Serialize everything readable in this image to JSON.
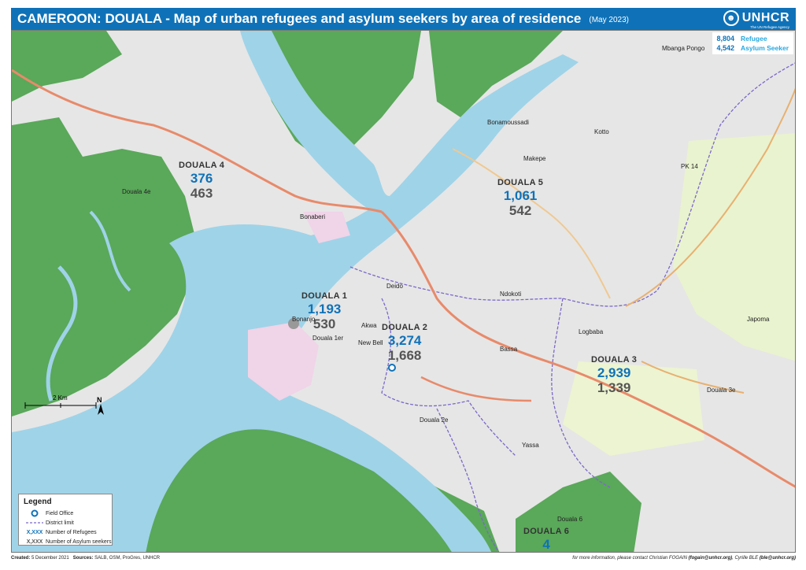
{
  "header": {
    "title": "CAMEROON: DOUALA -  Map of urban refugees and asylum seekers by area of residence",
    "date": "(May 2023)",
    "logo_text": "UNHCR",
    "logo_tagline": "The UN Refugee Agency"
  },
  "summary": {
    "refugees_value": "8,804",
    "refugees_label": "Refugee",
    "asylum_value": "4,542",
    "asylum_label": "Asylum Seeker"
  },
  "districts": [
    {
      "name": "DOUALA 4",
      "refugees": "376",
      "asylum": "463"
    },
    {
      "name": "DOUALA 5",
      "refugees": "1,061",
      "asylum": "542"
    },
    {
      "name": "DOUALA 1",
      "refugees": "1,193",
      "asylum": "530"
    },
    {
      "name": "DOUALA 2",
      "refugees": "3,274",
      "asylum": "1,668"
    },
    {
      "name": "DOUALA 3",
      "refugees": "2,939",
      "asylum": "1,339"
    },
    {
      "name": "DOUALA 6",
      "refugees": "4",
      "asylum": ""
    }
  ],
  "places": {
    "douala_4e": "Douala 4e",
    "douala_1er": "Douala 1er",
    "douala_2e": "Douala 2e",
    "douala_3e": "Douala 3e",
    "douala_6": "Douala 6",
    "bonaberi": "Bonaberi",
    "deido": "Deido",
    "akwa": "Akwa",
    "bonanjo": "Bonanjo",
    "new_bell": "New Bell",
    "bassa": "Bassa",
    "logbaba": "Logbaba",
    "japoma": "Japoma",
    "pk14": "PK 14",
    "makepe": "Makepe",
    "kotto": "Kotto",
    "bonamoussadi": "Bonamoussadi",
    "ndokoti": "Ndokoti",
    "yassa": "Yassa",
    "mbanga_pongo": "Mbanga Pongo"
  },
  "scale": {
    "label": "2 Km"
  },
  "north": {
    "label": "N"
  },
  "legend": {
    "title": "Legend",
    "items": [
      {
        "symbol": "",
        "label": "Field Office"
      },
      {
        "symbol": "",
        "label": "District limit"
      },
      {
        "symbol": "X,XXX",
        "label": "Number of Refugees"
      },
      {
        "symbol": "X,XXX",
        "label": "Number of Asylum seekers"
      }
    ]
  },
  "footer": {
    "created_label": "Created:",
    "created_value": "5 December 2021",
    "sources_label": "Sources:",
    "sources_value": "SALB, OSM, ProGres, UNHCR",
    "contact_prefix": "for more information, please contact Christian FOGAIN",
    "contact_1": "(fogain@unhcr.org)",
    "contact_mid": ", Cyrille BLE",
    "contact_2": "(ble@unhcr.org)"
  },
  "colors": {
    "header_bg": "#0f72b8",
    "water": "#9fd3e8",
    "mangrove": "#5aa85a",
    "urban": "#ececec",
    "refugee_text": "#0f72b8",
    "asylum_text": "#555555",
    "district_limit": "#7b68c8",
    "main_road": "#e88a6a"
  }
}
